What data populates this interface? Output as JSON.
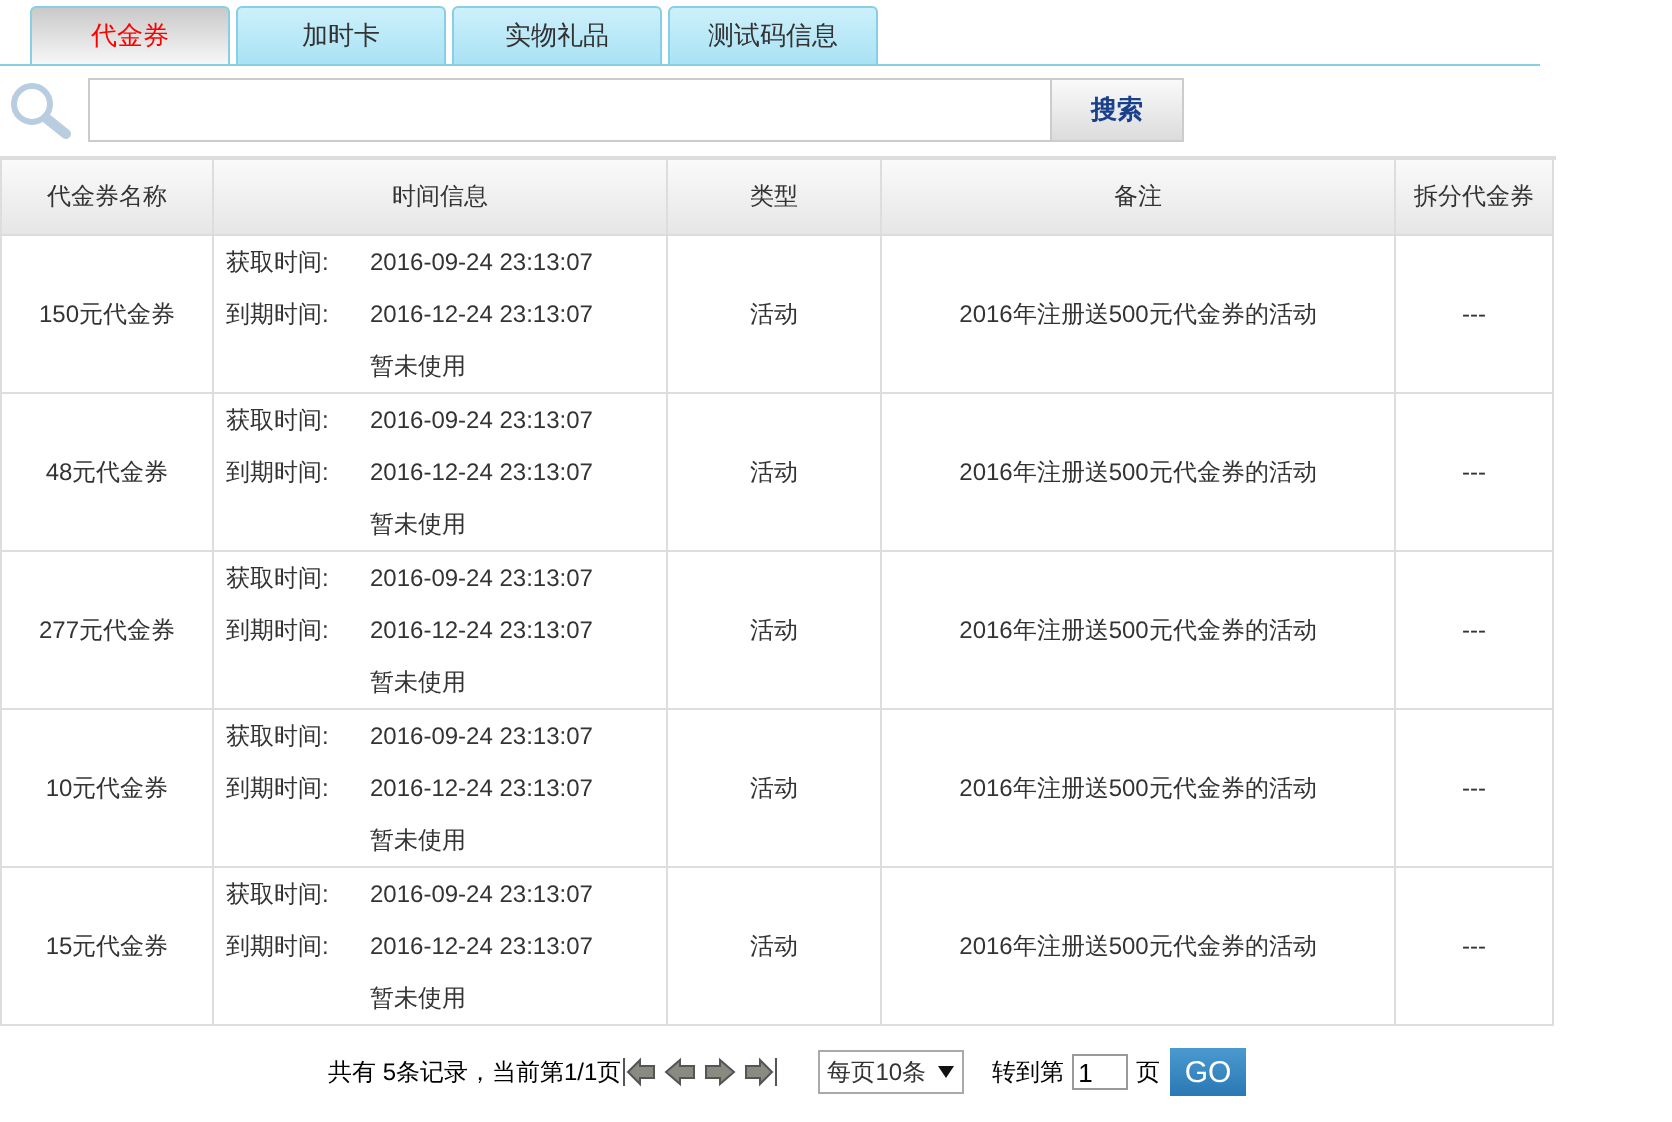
{
  "tabs": [
    {
      "label": "代金券",
      "selected": true
    },
    {
      "label": "加时卡",
      "selected": false
    },
    {
      "label": "实物礼品",
      "selected": false
    },
    {
      "label": "测试码信息",
      "selected": false
    }
  ],
  "search": {
    "button": "搜索"
  },
  "table": {
    "columns": [
      "代金券名称",
      "时间信息",
      "类型",
      "备注",
      "拆分代金券"
    ],
    "rows": [
      {
        "name": "150元代金券",
        "obtained_label": "获取时间:",
        "obtained": "2016-09-24 23:13:07",
        "expires_label": "到期时间:",
        "expires": "2016-12-24 23:13:07",
        "status": "暂未使用",
        "type": "活动",
        "note": "2016年注册送500元代金券的活动",
        "split": "---"
      },
      {
        "name": "48元代金券",
        "obtained_label": "获取时间:",
        "obtained": "2016-09-24 23:13:07",
        "expires_label": "到期时间:",
        "expires": "2016-12-24 23:13:07",
        "status": "暂未使用",
        "type": "活动",
        "note": "2016年注册送500元代金券的活动",
        "split": "---"
      },
      {
        "name": "277元代金券",
        "obtained_label": "获取时间:",
        "obtained": "2016-09-24 23:13:07",
        "expires_label": "到期时间:",
        "expires": "2016-12-24 23:13:07",
        "status": "暂未使用",
        "type": "活动",
        "note": "2016年注册送500元代金券的活动",
        "split": "---"
      },
      {
        "name": "10元代金券",
        "obtained_label": "获取时间:",
        "obtained": "2016-09-24 23:13:07",
        "expires_label": "到期时间:",
        "expires": "2016-12-24 23:13:07",
        "status": "暂未使用",
        "type": "活动",
        "note": "2016年注册送500元代金券的活动",
        "split": "---"
      },
      {
        "name": "15元代金券",
        "obtained_label": "获取时间:",
        "obtained": "2016-09-24 23:13:07",
        "expires_label": "到期时间:",
        "expires": "2016-12-24 23:13:07",
        "status": "暂未使用",
        "type": "活动",
        "note": "2016年注册送500元代金券的活动",
        "split": "---"
      }
    ]
  },
  "pagination": {
    "summary": "共有 5条记录，当前第1/1页",
    "page_size": "每页10条",
    "goto_label": "转到第",
    "page": "1",
    "page_unit": "页",
    "go": "GO"
  }
}
